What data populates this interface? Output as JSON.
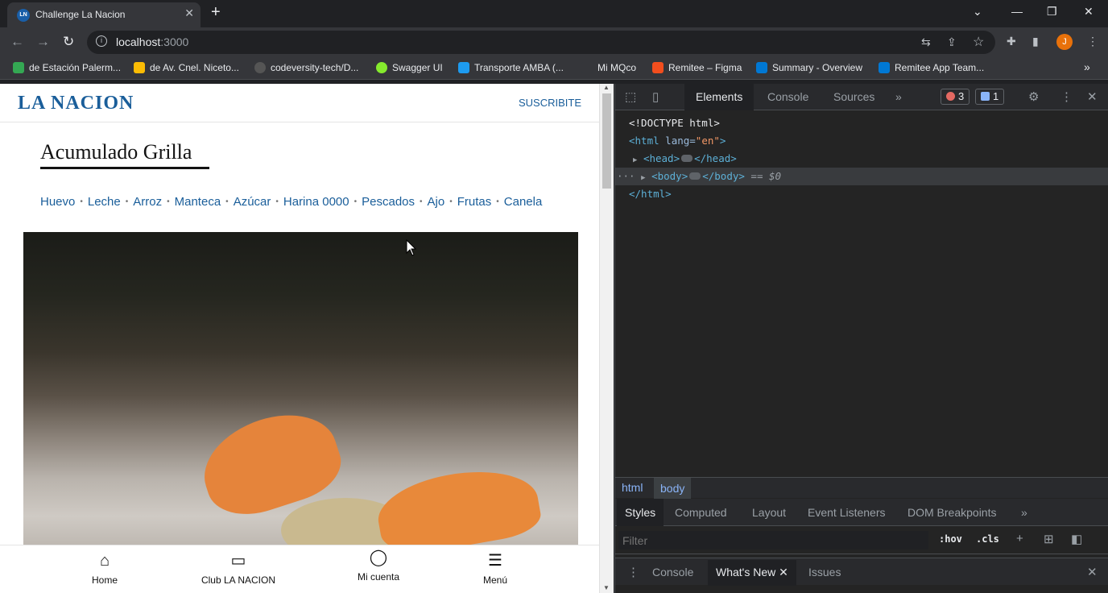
{
  "browser": {
    "tab_title": "Challenge La Nacion",
    "tab_favicon": "LN",
    "url_host": "localhost",
    "url_port": ":3000",
    "profile_initial": "J",
    "bookmarks": [
      {
        "label": "de Estación Palerm...",
        "color": "#34a853"
      },
      {
        "label": "de Av. Cnel. Niceto...",
        "color": "#fbbc04"
      },
      {
        "label": "codeversity-tech/D...",
        "color": "#555555"
      },
      {
        "label": "Swagger UI",
        "color": "#85ea2d"
      },
      {
        "label": "Transporte AMBA (...",
        "color": "#1d9bf0"
      },
      {
        "label": "Mi MQco",
        "color": "#35363a"
      },
      {
        "label": "Remitee – Figma",
        "color": "#f24e1e"
      },
      {
        "label": "Summary - Overview",
        "color": "#0078d4"
      },
      {
        "label": "Remitee App Team...",
        "color": "#0078d4"
      }
    ],
    "more_bookmarks": "»"
  },
  "page": {
    "logo": "LA NACION",
    "subscribe": "SUSCRIBITE",
    "title": "Acumulado Grilla",
    "categories": [
      "Huevo",
      "Leche",
      "Arroz",
      "Manteca",
      "Azúcar",
      "Harina 0000",
      "Pescados",
      "Ajo",
      "Frutas",
      "Canela"
    ],
    "bottom_nav": [
      {
        "label": "Home",
        "icon": "home-icon",
        "glyph": "⌂"
      },
      {
        "label": "Club LA NACION",
        "icon": "card-icon",
        "glyph": "▭"
      },
      {
        "label": "Mi cuenta",
        "icon": "user-icon",
        "glyph": "◯"
      },
      {
        "label": "Menú",
        "icon": "menu-icon",
        "glyph": "☰"
      }
    ]
  },
  "devtools": {
    "tabs": [
      "Elements",
      "Console",
      "Sources"
    ],
    "more_tabs": "»",
    "error_count": "3",
    "message_count": "1",
    "dom": {
      "doctype": "<!DOCTYPE html>",
      "html_open": "<html",
      "attr_name": " lang=",
      "attr_value": "\"en\"",
      "html_close_bracket": ">",
      "head_open": "<head>",
      "head_close": "</head>",
      "body_open": "<body>",
      "body_close": "</body>",
      "selected_marker": " == $0",
      "html_close": "</html>"
    },
    "breadcrumbs": [
      "html",
      "body"
    ],
    "styles_tabs": [
      "Styles",
      "Computed",
      "Layout",
      "Event Listeners",
      "DOM Breakpoints"
    ],
    "filter_placeholder": "Filter",
    "hov": ":hov",
    "cls": ".cls",
    "drawer_tabs": [
      "Console",
      "What's New",
      "Issues"
    ]
  }
}
